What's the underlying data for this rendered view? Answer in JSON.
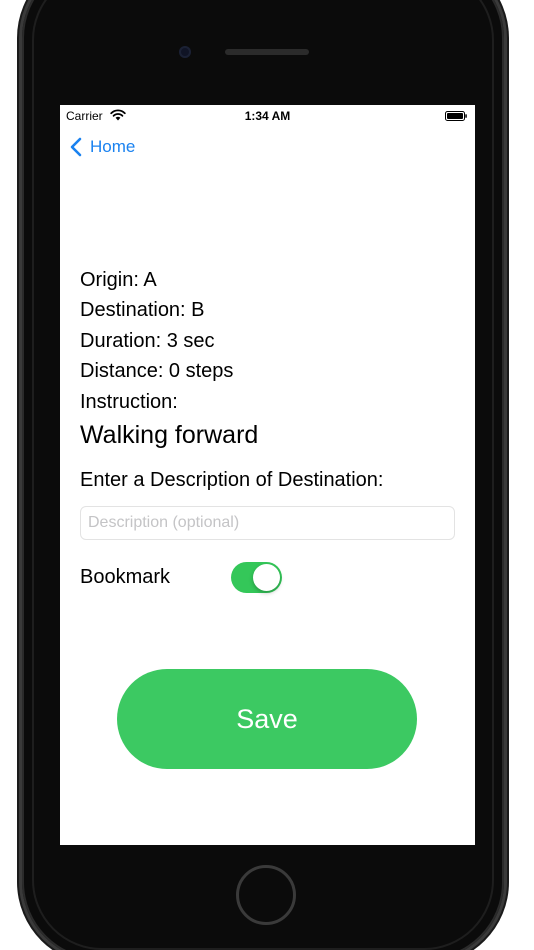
{
  "status_bar": {
    "carrier": "Carrier",
    "time": "1:34 AM",
    "wifi_icon": "wifi-icon",
    "battery_icon": "battery-icon"
  },
  "nav": {
    "back_label": "Home",
    "back_icon": "chevron-left-icon",
    "accent_color": "#1a82f0"
  },
  "details": {
    "origin": "Origin: A",
    "destination": "Destination: B",
    "duration": "Duration: 3 sec",
    "distance": "Distance: 0 steps",
    "instruction_label": "Instruction:",
    "instruction_value": "Walking forward"
  },
  "description": {
    "prompt": "Enter a Description of Destination:",
    "value": "",
    "placeholder": "Description (optional)"
  },
  "bookmark": {
    "label": "Bookmark",
    "enabled": true,
    "toggle_color": "#34c759"
  },
  "save": {
    "label": "Save",
    "color": "#3cc962"
  }
}
